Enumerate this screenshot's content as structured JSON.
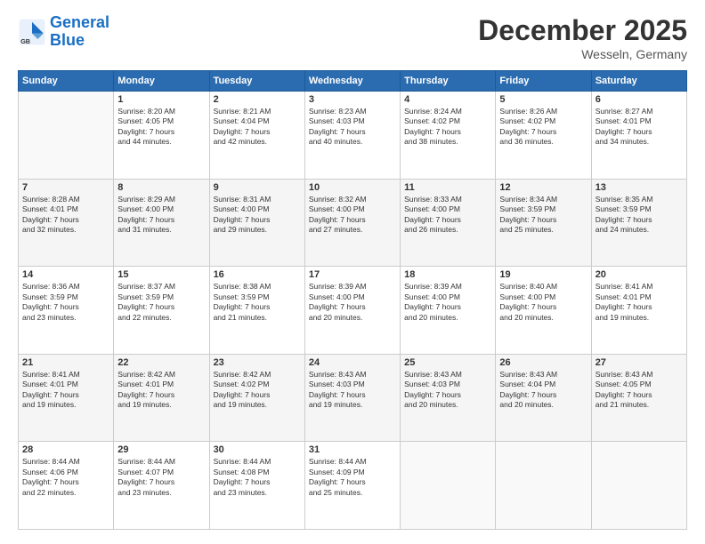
{
  "header": {
    "logo_line1": "General",
    "logo_line2": "Blue",
    "month": "December 2025",
    "location": "Wesseln, Germany"
  },
  "weekdays": [
    "Sunday",
    "Monday",
    "Tuesday",
    "Wednesday",
    "Thursday",
    "Friday",
    "Saturday"
  ],
  "weeks": [
    [
      {
        "day": "",
        "info": ""
      },
      {
        "day": "1",
        "info": "Sunrise: 8:20 AM\nSunset: 4:05 PM\nDaylight: 7 hours\nand 44 minutes."
      },
      {
        "day": "2",
        "info": "Sunrise: 8:21 AM\nSunset: 4:04 PM\nDaylight: 7 hours\nand 42 minutes."
      },
      {
        "day": "3",
        "info": "Sunrise: 8:23 AM\nSunset: 4:03 PM\nDaylight: 7 hours\nand 40 minutes."
      },
      {
        "day": "4",
        "info": "Sunrise: 8:24 AM\nSunset: 4:02 PM\nDaylight: 7 hours\nand 38 minutes."
      },
      {
        "day": "5",
        "info": "Sunrise: 8:26 AM\nSunset: 4:02 PM\nDaylight: 7 hours\nand 36 minutes."
      },
      {
        "day": "6",
        "info": "Sunrise: 8:27 AM\nSunset: 4:01 PM\nDaylight: 7 hours\nand 34 minutes."
      }
    ],
    [
      {
        "day": "7",
        "info": "Sunrise: 8:28 AM\nSunset: 4:01 PM\nDaylight: 7 hours\nand 32 minutes."
      },
      {
        "day": "8",
        "info": "Sunrise: 8:29 AM\nSunset: 4:00 PM\nDaylight: 7 hours\nand 31 minutes."
      },
      {
        "day": "9",
        "info": "Sunrise: 8:31 AM\nSunset: 4:00 PM\nDaylight: 7 hours\nand 29 minutes."
      },
      {
        "day": "10",
        "info": "Sunrise: 8:32 AM\nSunset: 4:00 PM\nDaylight: 7 hours\nand 27 minutes."
      },
      {
        "day": "11",
        "info": "Sunrise: 8:33 AM\nSunset: 4:00 PM\nDaylight: 7 hours\nand 26 minutes."
      },
      {
        "day": "12",
        "info": "Sunrise: 8:34 AM\nSunset: 3:59 PM\nDaylight: 7 hours\nand 25 minutes."
      },
      {
        "day": "13",
        "info": "Sunrise: 8:35 AM\nSunset: 3:59 PM\nDaylight: 7 hours\nand 24 minutes."
      }
    ],
    [
      {
        "day": "14",
        "info": "Sunrise: 8:36 AM\nSunset: 3:59 PM\nDaylight: 7 hours\nand 23 minutes."
      },
      {
        "day": "15",
        "info": "Sunrise: 8:37 AM\nSunset: 3:59 PM\nDaylight: 7 hours\nand 22 minutes."
      },
      {
        "day": "16",
        "info": "Sunrise: 8:38 AM\nSunset: 3:59 PM\nDaylight: 7 hours\nand 21 minutes."
      },
      {
        "day": "17",
        "info": "Sunrise: 8:39 AM\nSunset: 4:00 PM\nDaylight: 7 hours\nand 20 minutes."
      },
      {
        "day": "18",
        "info": "Sunrise: 8:39 AM\nSunset: 4:00 PM\nDaylight: 7 hours\nand 20 minutes."
      },
      {
        "day": "19",
        "info": "Sunrise: 8:40 AM\nSunset: 4:00 PM\nDaylight: 7 hours\nand 20 minutes."
      },
      {
        "day": "20",
        "info": "Sunrise: 8:41 AM\nSunset: 4:01 PM\nDaylight: 7 hours\nand 19 minutes."
      }
    ],
    [
      {
        "day": "21",
        "info": "Sunrise: 8:41 AM\nSunset: 4:01 PM\nDaylight: 7 hours\nand 19 minutes."
      },
      {
        "day": "22",
        "info": "Sunrise: 8:42 AM\nSunset: 4:01 PM\nDaylight: 7 hours\nand 19 minutes."
      },
      {
        "day": "23",
        "info": "Sunrise: 8:42 AM\nSunset: 4:02 PM\nDaylight: 7 hours\nand 19 minutes."
      },
      {
        "day": "24",
        "info": "Sunrise: 8:43 AM\nSunset: 4:03 PM\nDaylight: 7 hours\nand 19 minutes."
      },
      {
        "day": "25",
        "info": "Sunrise: 8:43 AM\nSunset: 4:03 PM\nDaylight: 7 hours\nand 20 minutes."
      },
      {
        "day": "26",
        "info": "Sunrise: 8:43 AM\nSunset: 4:04 PM\nDaylight: 7 hours\nand 20 minutes."
      },
      {
        "day": "27",
        "info": "Sunrise: 8:43 AM\nSunset: 4:05 PM\nDaylight: 7 hours\nand 21 minutes."
      }
    ],
    [
      {
        "day": "28",
        "info": "Sunrise: 8:44 AM\nSunset: 4:06 PM\nDaylight: 7 hours\nand 22 minutes."
      },
      {
        "day": "29",
        "info": "Sunrise: 8:44 AM\nSunset: 4:07 PM\nDaylight: 7 hours\nand 23 minutes."
      },
      {
        "day": "30",
        "info": "Sunrise: 8:44 AM\nSunset: 4:08 PM\nDaylight: 7 hours\nand 23 minutes."
      },
      {
        "day": "31",
        "info": "Sunrise: 8:44 AM\nSunset: 4:09 PM\nDaylight: 7 hours\nand 25 minutes."
      },
      {
        "day": "",
        "info": ""
      },
      {
        "day": "",
        "info": ""
      },
      {
        "day": "",
        "info": ""
      }
    ]
  ]
}
